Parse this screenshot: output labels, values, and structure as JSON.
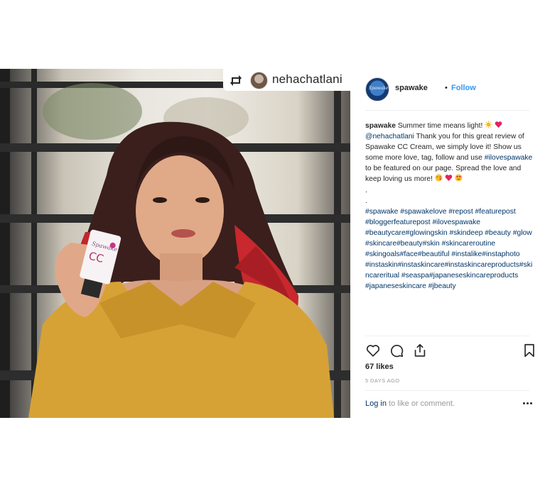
{
  "repost": {
    "username": "nehachatlani"
  },
  "post": {
    "username": "spawake",
    "separator": "•",
    "follow_label": "Follow",
    "avatar_text": "Spawake",
    "caption": {
      "username": "spawake",
      "line1": "Summer time means light!",
      "mention": "@nehachatlani",
      "body1": "Thank you for this great review of Spawake CC Cream, we simply love it! Show us some more love, tag, follow and use",
      "hashtag_inline": "#ilovespawake",
      "body2": "to be featured on our page. Spread the love and keep loving us more!",
      "dot1": ".",
      "dot2": ".",
      "hashtags": "#spawake #spawakelove #repost #featurepost #bloggerfeaturepost #ilovespawake #beautycare#glowingskin #skindeep #beauty #glow #skincare#beauty#skin #skincareroutine #skingoals#face#beautiful #instalike#instaphoto #instaskin#instaskincare#instaskincareproducts#skincareritual #seaspa#japaneseskincareproducts #japaneseskincare #jbeauty"
    },
    "likes": "67 likes",
    "time_ago": "5 DAYS AGO",
    "login_label": "Log in",
    "comment_prompt": "to like or comment."
  },
  "icons": [
    "repost-icon",
    "heart-icon",
    "comment-icon",
    "share-icon",
    "bookmark-icon",
    "more-options-icon",
    "sun-emoji-icon",
    "heart-emoji-icon",
    "wink-emoji-icon",
    "heart-eyes-emoji-icon"
  ],
  "colors": {
    "link": "#3897f0",
    "text": "#262626",
    "muted": "#999999",
    "hashtag": "#003569"
  }
}
